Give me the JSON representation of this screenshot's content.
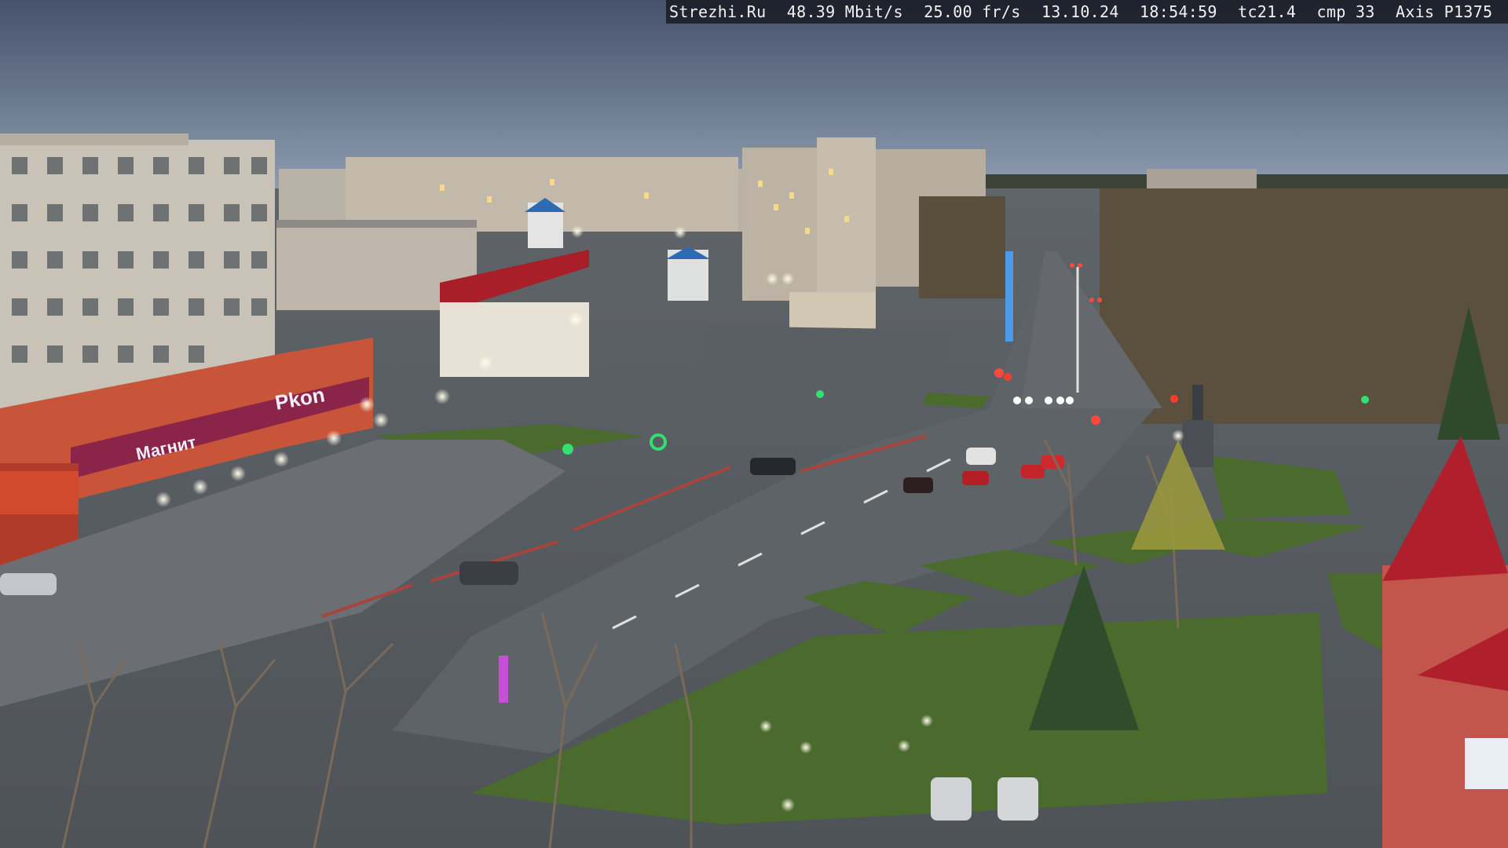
{
  "overlay": {
    "site": "Strezhi.Ru",
    "bitrate": "48.39 Mbit/s",
    "framerate": "25.00 fr/s",
    "date": "13.10.24",
    "time": "18:54:59",
    "tc": "tc21.4",
    "cmp": "cmp 33",
    "camera": "Axis P1375"
  },
  "signs": {
    "store_sign": "Магнит",
    "store_sign_right": "Pkon"
  },
  "palette": {
    "sky_top": "#4d5a6c",
    "sky_bottom": "#8a99ab",
    "road": "#5c6167",
    "grass": "#4a6a2e",
    "red_roof": "#b0202c",
    "brick_building": "#c9c2b6",
    "orange_store": "#c8553a"
  }
}
